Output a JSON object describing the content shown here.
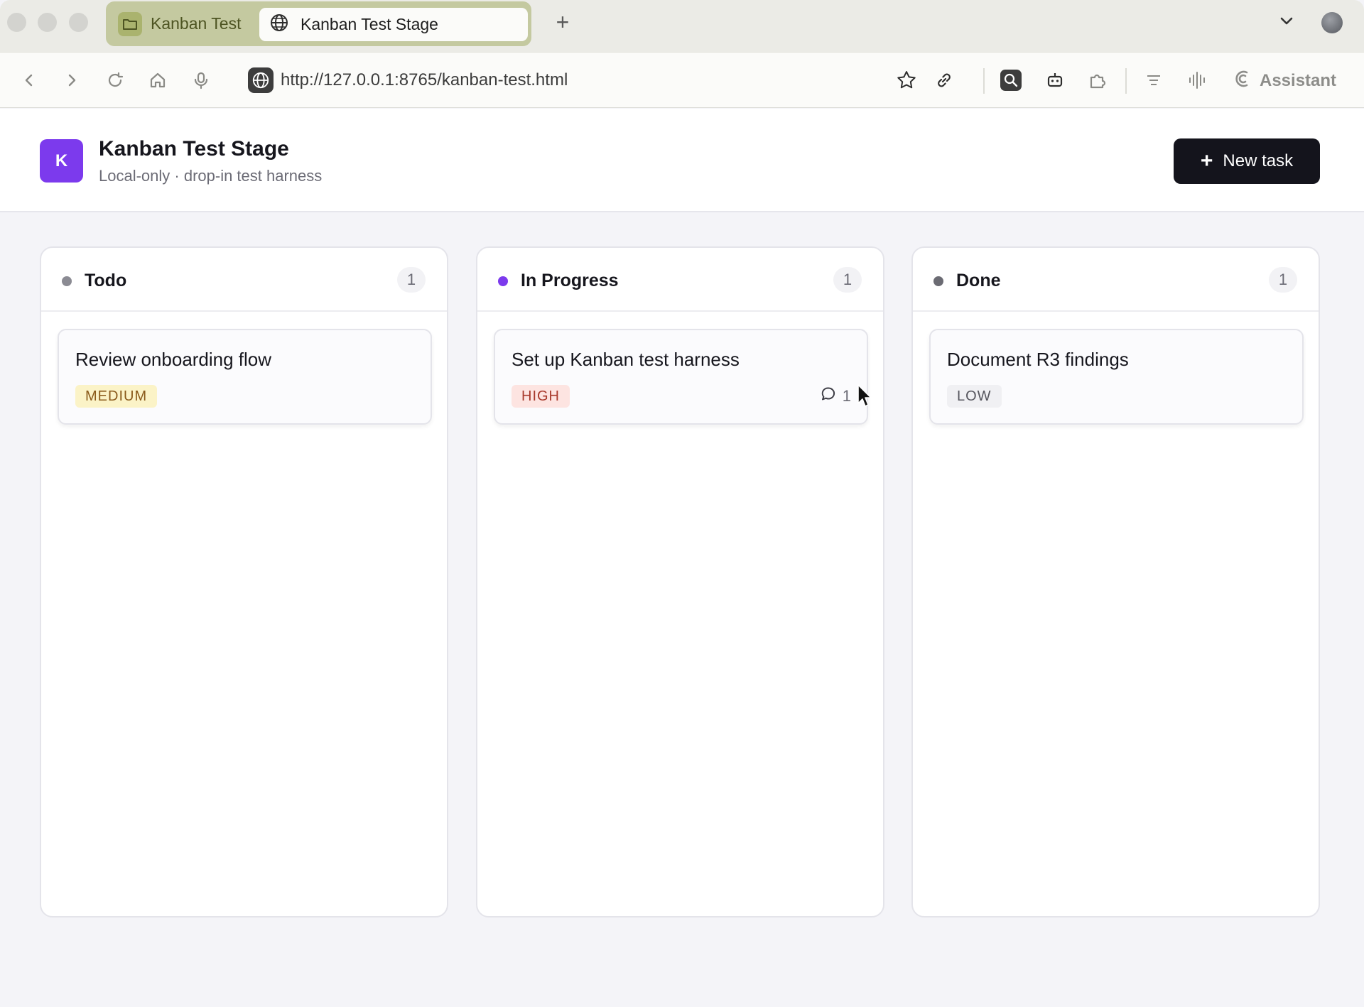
{
  "browser": {
    "tab_group_label": "Kanban Test",
    "active_tab_title": "Kanban Test Stage",
    "url": "http://127.0.0.1:8765/kanban-test.html",
    "assistant_label": "Assistant"
  },
  "header": {
    "logo_letter": "K",
    "title": "Kanban Test Stage",
    "subtitle": "Local-only · drop-in test harness",
    "new_task_label": "New task"
  },
  "columns": [
    {
      "title": "Todo",
      "count": "1",
      "dot_color": "#8b8b93",
      "cards": [
        {
          "title": "Review onboarding flow",
          "priority": "MEDIUM",
          "badge_bg": "#fbf3c7",
          "badge_fg": "#8a5a1a"
        }
      ]
    },
    {
      "title": "In Progress",
      "count": "1",
      "dot_color": "#7c3aed",
      "cards": [
        {
          "title": "Set up Kanban test harness",
          "priority": "HIGH",
          "badge_bg": "#fde4e1",
          "badge_fg": "#a8392c",
          "comment_count": "1"
        }
      ]
    },
    {
      "title": "Done",
      "count": "1",
      "dot_color": "#6b6b73",
      "cards": [
        {
          "title": "Document R3 findings",
          "priority": "LOW",
          "badge_bg": "#f0f0f3",
          "badge_fg": "#55555d"
        }
      ]
    }
  ]
}
